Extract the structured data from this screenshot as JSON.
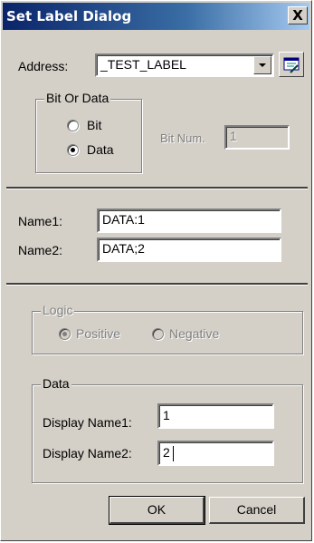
{
  "dialog": {
    "title": "Set Label Dialog",
    "close_glyph": "X"
  },
  "address": {
    "label": "Address:",
    "value": "_TEST_LABEL",
    "dropdown_icon": "chevron-down-icon",
    "browse_icon": "browse-icon"
  },
  "bit_or_data": {
    "title": "Bit Or Data",
    "options": [
      {
        "label": "Bit",
        "selected": false
      },
      {
        "label": "Data",
        "selected": true
      }
    ],
    "bit_num_label": "Bit Num.",
    "bit_num_value": "1"
  },
  "names": {
    "name1_label": "Name1:",
    "name1_value": "DATA:1",
    "name2_label": "Name2:",
    "name2_value": "DATA;2"
  },
  "logic": {
    "title": "Logic",
    "options": [
      {
        "label": "Positive",
        "selected": true
      },
      {
        "label": "Negative",
        "selected": false
      }
    ]
  },
  "data_group": {
    "title": "Data",
    "display1_label": "Display Name1:",
    "display1_value": "1",
    "display2_label": "Display Name2:",
    "display2_value": "2"
  },
  "buttons": {
    "ok": "OK",
    "cancel": "Cancel"
  },
  "colors": {
    "face": "#d4d0c8",
    "title_start": "#0a246a",
    "title_end": "#a6caf0"
  }
}
